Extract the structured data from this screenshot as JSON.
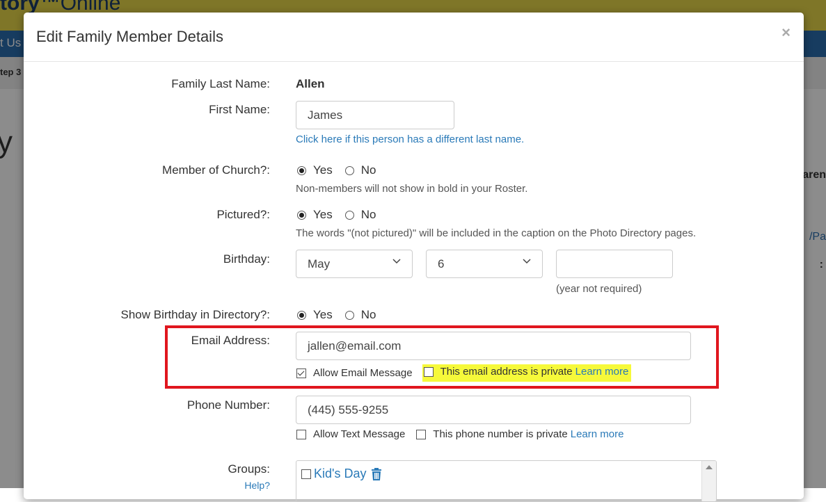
{
  "background": {
    "logo_text": "tory™",
    "logo_suffix": "Online",
    "nav_item": "t Us",
    "step_text": "tep 3",
    "heading_fragment": "y",
    "right_col_heading": "aren",
    "right_col_link": "/Pa",
    "right_col_colon": ":"
  },
  "modal": {
    "title": "Edit Family Member Details",
    "close_symbol": "×"
  },
  "form": {
    "family_last_name_label": "Family Last Name:",
    "family_last_name_value": "Allen",
    "first_name_label": "First Name:",
    "first_name_value": "James",
    "different_last_name_link": "Click here if this person has a different last name.",
    "member_label": "Member of Church?:",
    "member_selected": "Yes",
    "yes_label": "Yes",
    "no_label": "No",
    "member_help": "Non-members will not show in bold in your Roster.",
    "pictured_label": "Pictured?:",
    "pictured_selected": "Yes",
    "pictured_help": "The words \"(not pictured)\" will be included in the caption on the Photo Directory pages.",
    "birthday_label": "Birthday:",
    "birthday_month": "May",
    "birthday_day": "6",
    "birthday_year": "",
    "birthday_year_help": "(year not required)",
    "show_birthday_label": "Show Birthday in Directory?:",
    "show_birthday_selected": "Yes",
    "email_label": "Email Address:",
    "email_value": "jallen@email.com",
    "allow_email_label": "Allow Email Message",
    "allow_email_checked": true,
    "email_private_label": "This email address is private",
    "email_private_checked": false,
    "learn_more": "Learn more",
    "phone_label": "Phone Number:",
    "phone_value": "(445) 555-9255",
    "allow_text_label": "Allow Text Message",
    "allow_text_checked": false,
    "phone_private_label": "This phone number is private",
    "phone_private_checked": false,
    "groups_label": "Groups:",
    "groups_help_link": "Help?",
    "groups": [
      {
        "name": "Kid's Day",
        "checked": false
      }
    ]
  },
  "colors": {
    "accent_link": "#2a7ab8",
    "highlight_border": "#e0161e",
    "highlight_yellow": "#f6f93a",
    "header_yellow": "#e8d84a",
    "nav_blue": "#2a6db0"
  }
}
